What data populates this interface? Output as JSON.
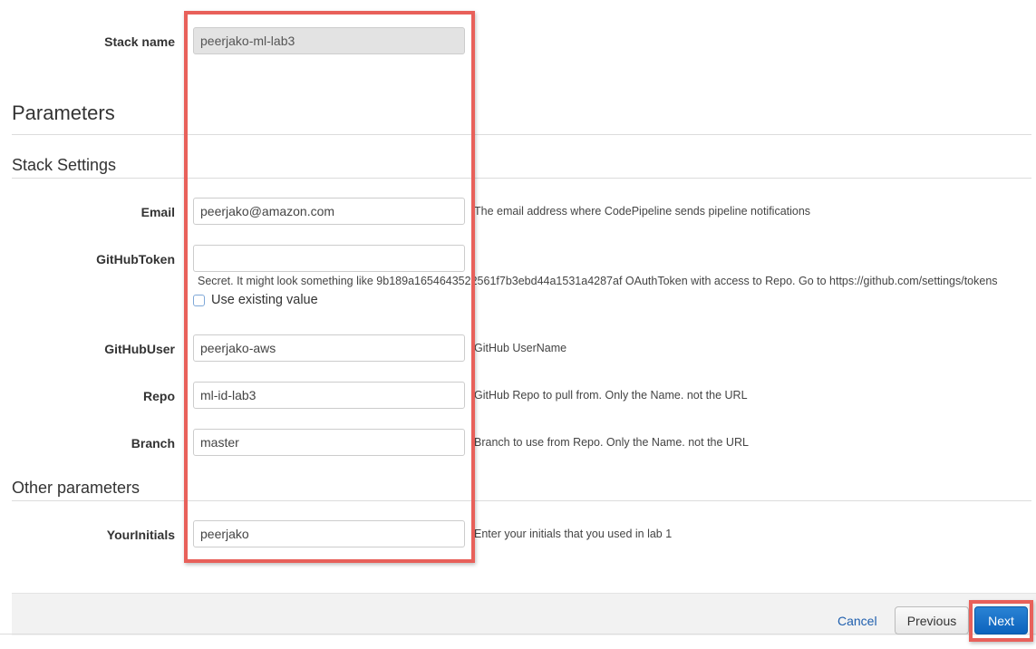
{
  "stack": {
    "label": "Stack name",
    "value": "peerjako-ml-lab3"
  },
  "sections": {
    "parameters": "Parameters",
    "stack_settings": "Stack Settings",
    "other_parameters": "Other parameters"
  },
  "fields": {
    "email": {
      "label": "Email",
      "value": "peerjako@amazon.com",
      "description": "The email address where CodePipeline sends pipeline notifications"
    },
    "github_token": {
      "label": "GitHubToken",
      "value": "",
      "description": "Secret. It might look something like 9b189a1654643522561f7b3ebd44a1531a4287af OAuthToken with access to Repo. Go to https://github.com/settings/tokens",
      "checkbox_label": "Use existing value",
      "checkbox_checked": false
    },
    "github_user": {
      "label": "GitHubUser",
      "value": "peerjako-aws",
      "description": "GitHub UserName"
    },
    "repo": {
      "label": "Repo",
      "value": "ml-id-lab3",
      "description": "GitHub Repo to pull from. Only the Name. not the URL"
    },
    "branch": {
      "label": "Branch",
      "value": "master",
      "description": "Branch to use from Repo. Only the Name. not the URL"
    },
    "your_initials": {
      "label": "YourInitials",
      "value": "peerjako",
      "description": "Enter your initials that you used in lab 1"
    }
  },
  "footer": {
    "cancel": "Cancel",
    "previous": "Previous",
    "next": "Next"
  },
  "colors": {
    "highlight": "#e8605a",
    "primary_button": "#0d63bd",
    "link": "#1f5fae"
  }
}
